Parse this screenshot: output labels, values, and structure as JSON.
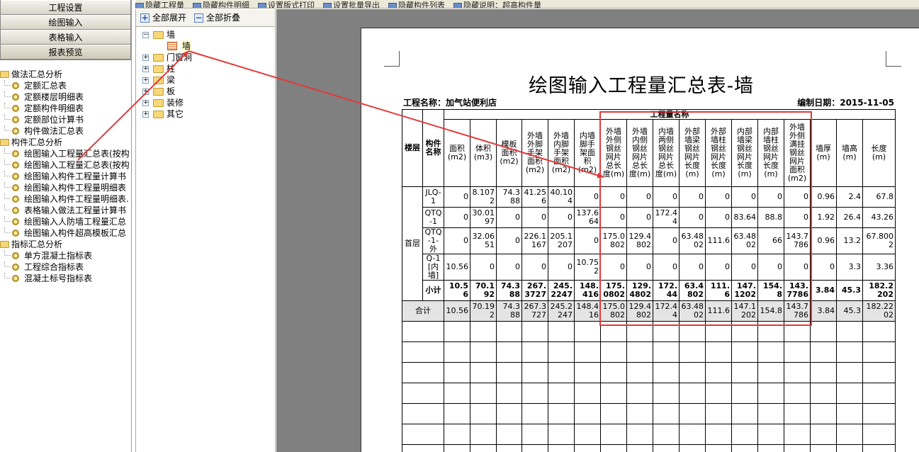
{
  "top_toolbar": {
    "items": [
      "隐藏工程量",
      "隐藏构件明细",
      "设置版式打印",
      "设置批量导出",
      "隐藏构件列表",
      "隐藏说明：超高构件量"
    ]
  },
  "left_nav": {
    "buttons": [
      "工程设置",
      "绘图输入",
      "表格输入",
      "报表预览"
    ],
    "groups": [
      {
        "label": "做法汇总分析",
        "items": [
          "定额汇总表",
          "定额楼层明细表",
          "定额构件明细表",
          "定额部位计算书",
          "构件做法汇总表"
        ]
      },
      {
        "label": "构件汇总分析",
        "items": [
          "绘图输入工程量汇总表(按构",
          "绘图输入工程量汇总表(按构",
          "绘图输入构件工程量计算书",
          "绘图输入构件工程量明细表",
          "绘图输入构件工程量明细表.",
          "表格输入做法工程量计算书",
          "绘图输入人防墙工程量汇总",
          "绘图输入构件超高模板汇总"
        ]
      },
      {
        "label": "指标汇总分析",
        "items": [
          "单方混凝土指标表",
          "工程综合指标表",
          "混凝土标号指标表"
        ]
      }
    ]
  },
  "mid_panel": {
    "expand_all": "全部展开",
    "collapse_all": "全部折叠",
    "tree": [
      {
        "label": "墙",
        "expanded": true,
        "children": [
          "墙"
        ]
      },
      {
        "label": "门窗洞"
      },
      {
        "label": "柱"
      },
      {
        "label": "梁"
      },
      {
        "label": "板"
      },
      {
        "label": "装修"
      },
      {
        "label": "其它"
      }
    ]
  },
  "report": {
    "title": "绘图输入工程量汇总表-墙",
    "project_label": "工程名称：加气站便利店",
    "date_label": "编制日期：2015-11-05",
    "group_header": "工程量名称",
    "floor_header": "楼层",
    "comp_header": "构件名称",
    "columns": [
      "面积(m2)",
      "体积(m3)",
      "模板面积(m2)",
      "外墙外脚手架面积(m2)",
      "外墙内脚手架面积(m2)",
      "内墙脚手架面积(m2)",
      "外墙外侧钢丝网片总长度(m)",
      "外墙内侧钢丝网片总长度(m)",
      "内墙两侧钢丝网片总长度(m)",
      "外部墙梁钢丝网片长度(m)",
      "外部墙柱钢丝网片长度(m)",
      "内部墙梁钢丝网片长度(m)",
      "内部墙柱钢丝网片长度(m)",
      "外墙外侧满挂钢丝网片面积(m2)",
      "墙厚(m)",
      "墙高(m)",
      "长度(m)"
    ],
    "floor": "首层",
    "rows": [
      {
        "name": "JLQ-1",
        "values": [
          "0",
          "8.1072",
          "74.388",
          "41.256",
          "40.104",
          "0",
          "0",
          "0",
          "0",
          "0",
          "0",
          "0",
          "0",
          "0",
          "0.96",
          "2.4",
          "67.8"
        ]
      },
      {
        "name": "QTQ-1",
        "values": [
          "0",
          "30.0197",
          "0",
          "0",
          "0",
          "137.664",
          "0",
          "0",
          "172.44",
          "0",
          "0",
          "83.64",
          "88.8",
          "0",
          "1.92",
          "26.4",
          "43.26"
        ]
      },
      {
        "name": "QTQ-1-外",
        "values": [
          "0",
          "32.0651",
          "0",
          "226.1167",
          "205.1207",
          "0",
          "175.0802",
          "129.4802",
          "0",
          "63.4802",
          "111.6",
          "63.4802",
          "66",
          "143.7786",
          "0.96",
          "13.2",
          "67.8002"
        ]
      },
      {
        "name": "Q-1[内墙]",
        "values": [
          "10.56",
          "0",
          "0",
          "0",
          "0",
          "10.752",
          "0",
          "0",
          "0",
          "0",
          "0",
          "0",
          "0",
          "0",
          "0",
          "3.3",
          "3.36"
        ]
      }
    ],
    "subtotal": {
      "name": "小计",
      "values": [
        "10.56",
        "70.192",
        "74.388",
        "267.3727",
        "245.2247",
        "148.416",
        "175.0802",
        "129.4802",
        "172.44",
        "63.4802",
        "111.6",
        "147.1202",
        "154.8",
        "143.7786",
        "3.84",
        "45.3",
        "182.2202"
      ]
    },
    "total": {
      "name": "合计",
      "values": [
        "10.56",
        "70.192",
        "74.388",
        "267.3727",
        "245.2247",
        "148.416",
        "175.0802",
        "129.4802",
        "172.44",
        "63.4802",
        "111.6",
        "147.1202",
        "154.8",
        "143.7786",
        "3.84",
        "45.3",
        "182.2202"
      ]
    }
  },
  "annotation_color": "#e03a3a"
}
